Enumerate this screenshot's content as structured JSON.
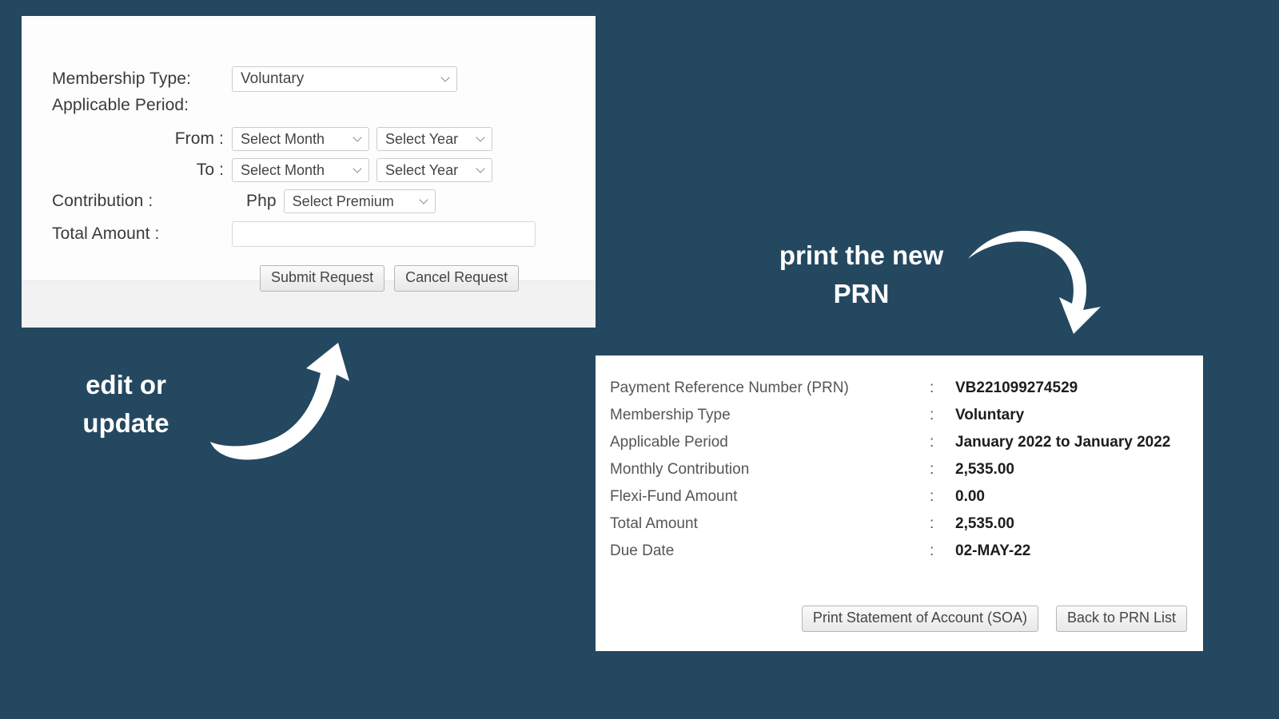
{
  "background_color": "#244860",
  "form_panel": {
    "membership_type": {
      "label": "Membership Type:",
      "value": "Voluntary"
    },
    "applicable_period_label": "Applicable Period:",
    "from": {
      "label": "From  :",
      "month": "Select Month",
      "year": "Select Year"
    },
    "to": {
      "label": "To  :",
      "month": "Select Month",
      "year": "Select Year"
    },
    "contribution": {
      "label": "Contribution  :",
      "currency": "Php",
      "premium": "Select Premium"
    },
    "total_amount": {
      "label": "Total Amount  :",
      "value": ""
    },
    "buttons": {
      "submit": "Submit Request",
      "cancel": "Cancel Request"
    }
  },
  "prn_panel": {
    "rows": [
      {
        "label": "Payment Reference Number (PRN)",
        "colon": ":",
        "value": "VB221099274529"
      },
      {
        "label": "Membership Type",
        "colon": ":",
        "value": "Voluntary"
      },
      {
        "label": "Applicable Period",
        "colon": ":",
        "value": "January 2022 to January 2022"
      },
      {
        "label": "Monthly Contribution",
        "colon": ":",
        "value": "2,535.00"
      },
      {
        "label": "Flexi-Fund Amount",
        "colon": ":",
        "value": "0.00"
      },
      {
        "label": "Total Amount",
        "colon": ":",
        "value": "2,535.00"
      },
      {
        "label": "Due Date",
        "colon": ":",
        "value": "02-MAY-22"
      }
    ],
    "buttons": {
      "print_soa": "Print Statement of Account (SOA)",
      "back": "Back to PRN List"
    }
  },
  "annotations": {
    "edit_update": "edit or\nupdate",
    "print_prn": "print the new\nPRN",
    "color": "#ffffff"
  }
}
